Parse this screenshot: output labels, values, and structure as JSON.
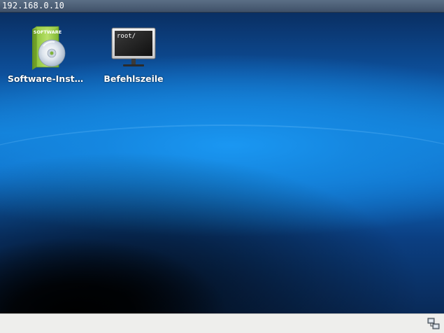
{
  "window": {
    "title": "192.168.0.10"
  },
  "desktop": {
    "icons": [
      {
        "label": "Software-Inst…",
        "icon": "software-box-cd-icon",
        "box_text": "SOFTWARE"
      },
      {
        "label": "Befehlszeile",
        "icon": "terminal-monitor-icon",
        "screen_text": "root/"
      }
    ]
  },
  "taskbar": {
    "tray_icon": "network-icon"
  },
  "colors": {
    "topbar": "#4b5d74",
    "desktop_accent": "#1587e0",
    "taskbar": "#eeeeec"
  }
}
